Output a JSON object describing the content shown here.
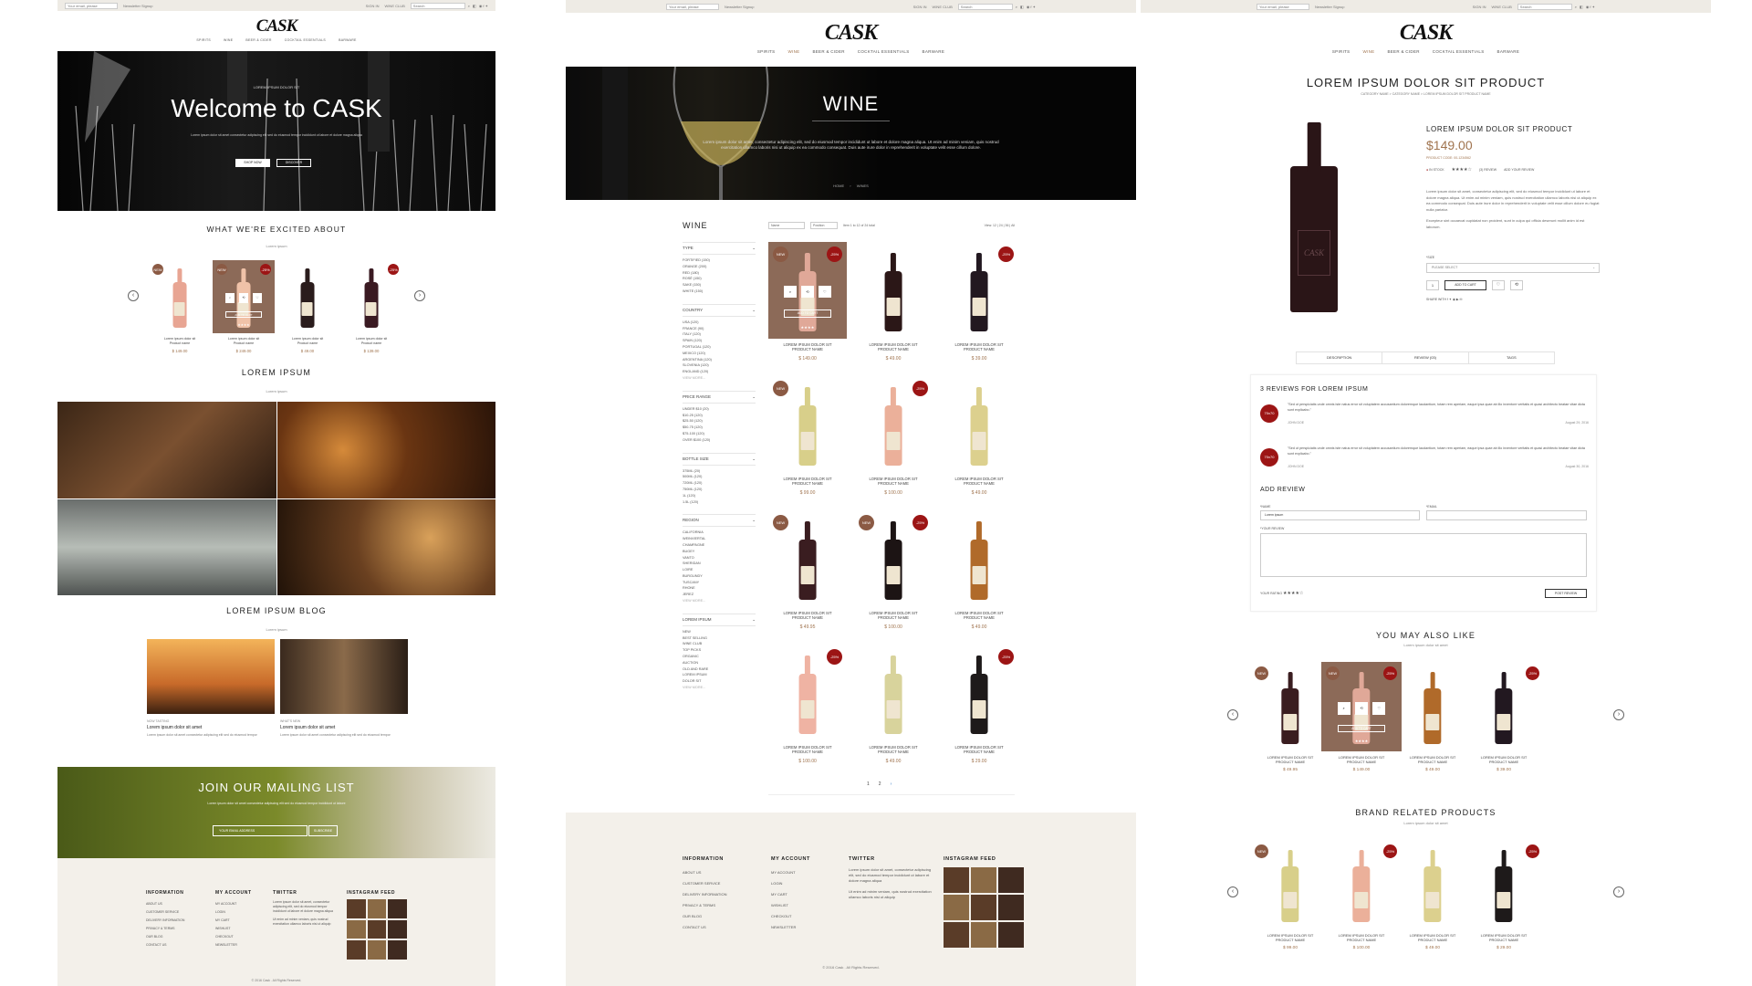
{
  "topbar": {
    "email_placeholder": "Your email, please",
    "newsletter": "Newsletter Signup",
    "sign_in": "SIGN IN",
    "wine_club": "WINE CLUB",
    "search_placeholder": "Search"
  },
  "brand": {
    "logo": "CASK"
  },
  "nav": [
    "SPIRITS",
    "WINE",
    "BEER & CIDER",
    "COCKTAIL ESSENTIALS",
    "BARWARE"
  ],
  "colors": {
    "accent": "#a0744f",
    "sale": "#9c1515",
    "new": "#8b5a44",
    "footer": "#f3f0ea"
  },
  "home": {
    "hero": {
      "kicker": "LOREM IPSUM DOLOR SIT",
      "title": "Welcome to CASK",
      "text": "Lorem ipsum dolor sit amet consectetur adipiscing elit sed do eiusmod tempor incididunt ut labore et dolore magna aliqua",
      "btn_shop": "SHOP NOW",
      "btn_discover": "DISCOVER"
    },
    "excited": {
      "title": "WHAT WE'RE EXCITED ABOUT",
      "sub": "Lorem ipsum",
      "products": [
        {
          "name": "Lorem ipsum dolor sit\nProduct name",
          "price": "$ 149.00",
          "badge": "NEW",
          "color": "#e8a593"
        },
        {
          "name": "Lorem ipsum dolor sit\nProduct name",
          "price": "$ 249.00",
          "badge": "NEW",
          "badge2": "-25%",
          "color": "#f0c2a8",
          "hover": true
        },
        {
          "name": "Lorem ipsum dolor sit\nProduct name",
          "price": "$ 49.00",
          "color": "#2a1c1c"
        },
        {
          "name": "Lorem ipsum dolor sit\nProduct name",
          "price": "$ 139.00",
          "badge2": "-25%",
          "color": "#3a1a22"
        }
      ],
      "add_to_cart": "ADD TO CART"
    },
    "gallery": {
      "title": "LOREM IPSUM",
      "sub": "Lorem ipsum"
    },
    "blog": {
      "title": "LOREM IPSUM BLOG",
      "sub": "Lorem ipsum",
      "posts": [
        {
          "tag": "NOW TASTING",
          "title": "Lorem ipsum dolor sit amet",
          "text": "Lorem ipsum dolor sit amet consectetur adipiscing elit sed do eiusmod tempor"
        },
        {
          "tag": "WHAT'S NEW",
          "title": "Lorem ipsum dolor sit amet",
          "text": "Lorem ipsum dolor sit amet consectetur adipiscing elit sed do eiusmod tempor"
        }
      ]
    },
    "mailing": {
      "title": "JOIN OUR MAILING LIST",
      "text": "Lorem ipsum dolor sit amet consectetur adipiscing elit sed do eiusmod tempor incididunt ut labore",
      "placeholder": "YOUR EMAIL ADDRESS",
      "btn": "SUBSCRIBE"
    }
  },
  "footer": {
    "information_title": "INFORMATION",
    "information": [
      "ABOUT US",
      "CUSTOMER SERVICE",
      "DELIVERY INFORMATION",
      "PRIVACY & TERMS",
      "OUR BLOG",
      "CONTACT US"
    ],
    "account_title": "MY ACCOUNT",
    "account": [
      "MY ACCOUNT",
      "LOGIN",
      "MY CART",
      "WISHLIST",
      "CHECKOUT",
      "NEWSLETTER"
    ],
    "twitter_title": "TWITTER",
    "twitter_text": "Lorem ipsum dolor sit amet, consectetur adipiscing elit, sed do eiusmod tempor incididunt ut labore et dolore magna aliqua",
    "twitter_text2": "Ut enim ad minim veniam, quis nostrud exercitation ullamco laboris nisi ut aliquip",
    "insta_title": "INSTAGRAM FEED",
    "copyright": "© 2016 Cask . All Rights Reserved."
  },
  "category": {
    "banner_title": "WINE",
    "banner_text": "Lorem ipsum dolor sit amet, consectetur adipiscing elit, sed do eiusmod tempor incididunt ut labore et dolore magna aliqua. Ut enim ad minim veniam, quis nostrud exercitation ullamco laboris nisi ut aliquip ex ea commodo consequat. Duis aute irure dolor in reprehenderit in voluptate velit esse cillum dolore.",
    "breadcrumb": [
      "HOME",
      "WINES"
    ],
    "sidebar_title": "WINE",
    "sort_label": "Position",
    "show_label": "Name",
    "items_text": "Item 1 to 12 of 24 total",
    "view_text": "View: 12 | 24 | 36 | All",
    "filters": [
      {
        "title": "TYPE",
        "items": [
          "FORTIFIED (150)",
          "ORANGE (200)",
          "RED (180)",
          "ROSÉ (150)",
          "SAKE (150)",
          "WHITE (150)"
        ]
      },
      {
        "title": "COUNTRY",
        "items": [
          "USA (120)",
          "FRANCE (90)",
          "ITALY (120)",
          "SPAIN (120)",
          "PORTUGAL (120)",
          "MEXICO (120)",
          "ARGENTINA (120)",
          "SLOVENIA (120)",
          "ENGLAND (120)",
          "VIEW MORE..."
        ]
      },
      {
        "title": "PRICE RANGE",
        "items": [
          "UNDER $10 (20)",
          "$10-25 (120)",
          "$25-50 (120)",
          "$50-75 (120)",
          "$75-100 (120)",
          "OVER $100 (120)"
        ]
      },
      {
        "title": "BOTTLE SIZE",
        "items": [
          "375ML (20)",
          "500ML (120)",
          "720ML (120)",
          "750ML (120)",
          "1L (120)",
          "1.5L (120)"
        ]
      },
      {
        "title": "REGION",
        "items": [
          "CALIFORNIA",
          "WEINVIERTAL",
          "CHAMPAGNE",
          "BUGEY",
          "VANTO",
          "SHERIDAN",
          "LOIRE",
          "BURGUNDY",
          "TUSCANY",
          "RHONE",
          "JEREZ",
          "VIEW MORE..."
        ]
      },
      {
        "title": "LOREM IPSUM",
        "items": [
          "NEW",
          "BEST SELLING",
          "WINE CLUB",
          "TOP PICKS",
          "ORGANIC",
          "AUCTION",
          "OLD AND RARE",
          "LOREM IPSUM",
          "DOLOR SIT",
          "VIEW MORE..."
        ]
      }
    ],
    "products": [
      {
        "name": "LOREM IPSUM DOLOR SIT\nPRODUCT NAME",
        "price": "$ 149.00",
        "badge": "NEW",
        "badge2": "-25%",
        "color": "#e0a898",
        "hover": true
      },
      {
        "name": "LOREM IPSUM DOLOR SIT\nPRODUCT NAME",
        "price": "$ 49.00",
        "color": "#2b1717"
      },
      {
        "name": "LOREM IPSUM DOLOR SIT\nPRODUCT NAME",
        "price": "$ 39.00",
        "badge2": "-25%",
        "color": "#221820"
      },
      {
        "name": "LOREM IPSUM DOLOR SIT\nPRODUCT NAME",
        "price": "$ 99.00",
        "badge": "NEW",
        "color": "#d8cf8a"
      },
      {
        "name": "LOREM IPSUM DOLOR SIT\nPRODUCT NAME",
        "price": "$ 100.00",
        "badge2": "-25%",
        "color": "#ebb09a"
      },
      {
        "name": "LOREM IPSUM DOLOR SIT\nPRODUCT NAME",
        "price": "$ 49.00",
        "color": "#dcd08e"
      },
      {
        "name": "LOREM IPSUM DOLOR SIT\nPRODUCT NAME",
        "price": "$ 49.95",
        "badge": "NEW",
        "color": "#3a1d20"
      },
      {
        "name": "LOREM IPSUM DOLOR SIT\nPRODUCT NAME",
        "price": "$ 100.00",
        "badge": "NEW",
        "badge2": "-25%",
        "color": "#1c1414"
      },
      {
        "name": "LOREM IPSUM DOLOR SIT\nPRODUCT NAME",
        "price": "$ 49.00",
        "color": "#b06a2a"
      },
      {
        "name": "LOREM IPSUM DOLOR SIT\nPRODUCT NAME",
        "price": "$ 100.00",
        "badge2": "-25%",
        "color": "#efb3a3"
      },
      {
        "name": "LOREM IPSUM DOLOR SIT\nPRODUCT NAME",
        "price": "$ 49.00",
        "color": "#d8d39c"
      },
      {
        "name": "LOREM IPSUM DOLOR SIT\nPRODUCT NAME",
        "price": "$ 29.00",
        "badge2": "-25%",
        "color": "#1e1a1a"
      }
    ],
    "add_to_cart": "ADD TO CART",
    "pages": [
      "1",
      "2",
      "›"
    ]
  },
  "product": {
    "title": "LOREM IPSUM DOLOR SIT PRODUCT",
    "breadcrumb": "CATEGORY NAME  >  CATEGORY NAME  >  LOREM IPSUM DOLOR SIT PRODUCT NAME",
    "name": "LOREM IPSUM DOLOR SIT PRODUCT",
    "price": "$149.00",
    "code": "PRODUCT CODE: 00-1234562",
    "stock": "IN STOCK",
    "reviews_link": "(3) REVIEW",
    "add_review_link": "ADD YOUR REVIEW",
    "desc1": "Lorem ipsum dolor sit amet, consectetur adipiscing elit, sed do eiusmod tempor incididunt ut labore et dolore magna aliqua. Ut enim ad minim veniam, quis nostrud exercitation ullamco laboris nisi ut aliquip ex ea commodo consequat. Duis aute irure dolor in reprehenderit in voluptate velit esse cillum dolore eu fugiat nulla pariatur.",
    "desc2": "Excepteur sint occaecat cupidatat non proident, sunt in culpa qui officia deserunt mollit anim id est laborum.",
    "size_label": "*SIZE",
    "size_placeholder": "PLEASE SELECT",
    "qty": "1",
    "add_to_cart": "ADD TO CART",
    "share": "SHARE WITH",
    "tabs": [
      "DESCRIPTION",
      "REVIEW (03)",
      "TAGS"
    ],
    "reviews_title": "3 REVIEWS FOR LOREM IPSUM",
    "reviews": [
      {
        "avatar": "70x70",
        "text": "\"Sed ut perspiciatis unde omnis iste natus error sit voluptatem accusantium doloremque laudantium, totam rem aperiam, eaque ipsa quae ab illo inventore veritatis et quasi architecto beatae vitae dicta sunt explicabo.\"",
        "author": "JOHN DOE",
        "date": "August 29, 2016"
      },
      {
        "avatar": "70x70",
        "text": "\"Sed ut perspiciatis unde omnis iste natus error sit voluptatem accusantium doloremque laudantium, totam rem aperiam, eaque ipsa quae ab illo inventore veritatis et quasi architecto beatae vitae dicta sunt explicabo.\"",
        "author": "JOHN DOE",
        "date": "August 30, 2016"
      }
    ],
    "add_review_title": "ADD REVIEW",
    "name_label": "*NAME",
    "name_value": "Lorem ipsum",
    "email_label": "*EMAIL",
    "review_label": "*YOUR REVIEW",
    "rating_label": "YOUR RATING",
    "post_btn": "POST REVIEW",
    "also_title": "YOU MAY ALSO LIKE",
    "also_sub": "Lorem ipsum dolor sit amet",
    "also": [
      {
        "name": "LOREM IPSUM DOLOR SIT\nPRODUCT NAME",
        "price": "$ 49.95",
        "badge": "NEW",
        "color": "#3a1d20"
      },
      {
        "name": "LOREM IPSUM DOLOR SIT\nPRODUCT NAME",
        "price": "$ 149.00",
        "badge": "NEW",
        "badge2": "-25%",
        "color": "#e0a898",
        "hover": true
      },
      {
        "name": "LOREM IPSUM DOLOR SIT\nPRODUCT NAME",
        "price": "$ 49.00",
        "color": "#b06a2a"
      },
      {
        "name": "LOREM IPSUM DOLOR SIT\nPRODUCT NAME",
        "price": "$ 39.00",
        "badge2": "-25%",
        "color": "#221820"
      }
    ],
    "brand_title": "BRAND RELATED PRODUCTS",
    "brand_sub": "Lorem ipsum dolor sit amet",
    "brand": [
      {
        "name": "LOREM IPSUM DOLOR SIT\nPRODUCT NAME",
        "price": "$ 99.00",
        "badge": "NEW",
        "color": "#d8cf8a"
      },
      {
        "name": "LOREM IPSUM DOLOR SIT\nPRODUCT NAME",
        "price": "$ 100.00",
        "badge2": "-25%",
        "color": "#ebb09a"
      },
      {
        "name": "LOREM IPSUM DOLOR SIT\nPRODUCT NAME",
        "price": "$ 49.00",
        "color": "#dcd08e"
      },
      {
        "name": "LOREM IPSUM DOLOR SIT\nPRODUCT NAME",
        "price": "$ 29.00",
        "badge2": "-25%",
        "color": "#1e1a1a"
      }
    ]
  }
}
